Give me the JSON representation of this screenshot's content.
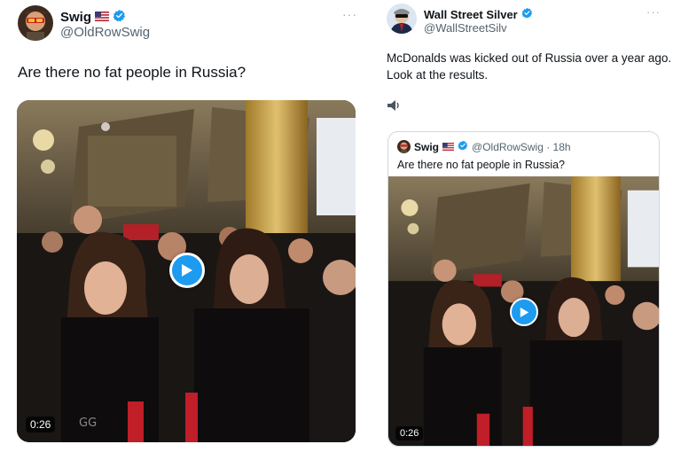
{
  "left_tweet": {
    "display_name": "Swig",
    "handle": "@OldRowSwig",
    "more": "···",
    "text": "Are there no fat people in Russia?",
    "video": {
      "duration": "0:26"
    }
  },
  "right_tweet": {
    "display_name": "Wall Street Silver",
    "handle": "@WallStreetSilv",
    "more": "···",
    "text_line1": "McDonalds was kicked out of Russia over a year ago.",
    "text_line2": "Look at the results.",
    "emoji_icon": "speaker-icon",
    "quoted": {
      "display_name": "Swig",
      "handle_time": "@OldRowSwig · 18h",
      "text": "Are there no fat people in Russia?",
      "video": {
        "duration": "0:26"
      }
    }
  },
  "colors": {
    "accent": "#1d9bf0",
    "verified": "#1d9bf0",
    "muted": "#536471"
  }
}
